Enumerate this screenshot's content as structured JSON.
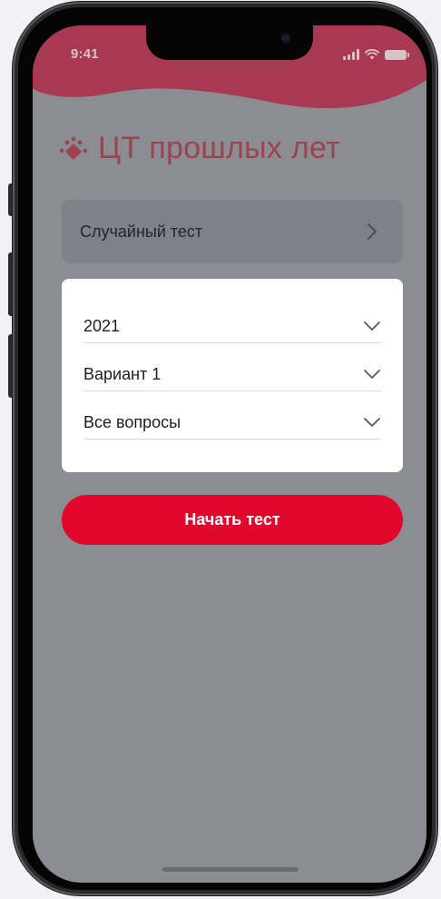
{
  "status_bar": {
    "time": "9:41",
    "icons": [
      "signal-icon",
      "wifi-icon",
      "battery-icon"
    ]
  },
  "header": {
    "title": "ЦТ прошлых лет",
    "logo_icon": "diamond-logo-icon"
  },
  "random_test": {
    "label": "Случайный тест",
    "icon": "chevron-right-icon"
  },
  "filters": {
    "year": {
      "value": "2021",
      "icon": "chevron-down-icon"
    },
    "variant": {
      "value": "Вариант 1",
      "icon": "chevron-down-icon"
    },
    "questions": {
      "value": "Все вопросы",
      "icon": "chevron-down-icon"
    }
  },
  "start_button": {
    "label": "Начать тест"
  },
  "colors": {
    "header_bg": "#a73a52",
    "accent": "#e1062c",
    "title": "#9c4350",
    "overlay_bg": "#8c8d93"
  }
}
